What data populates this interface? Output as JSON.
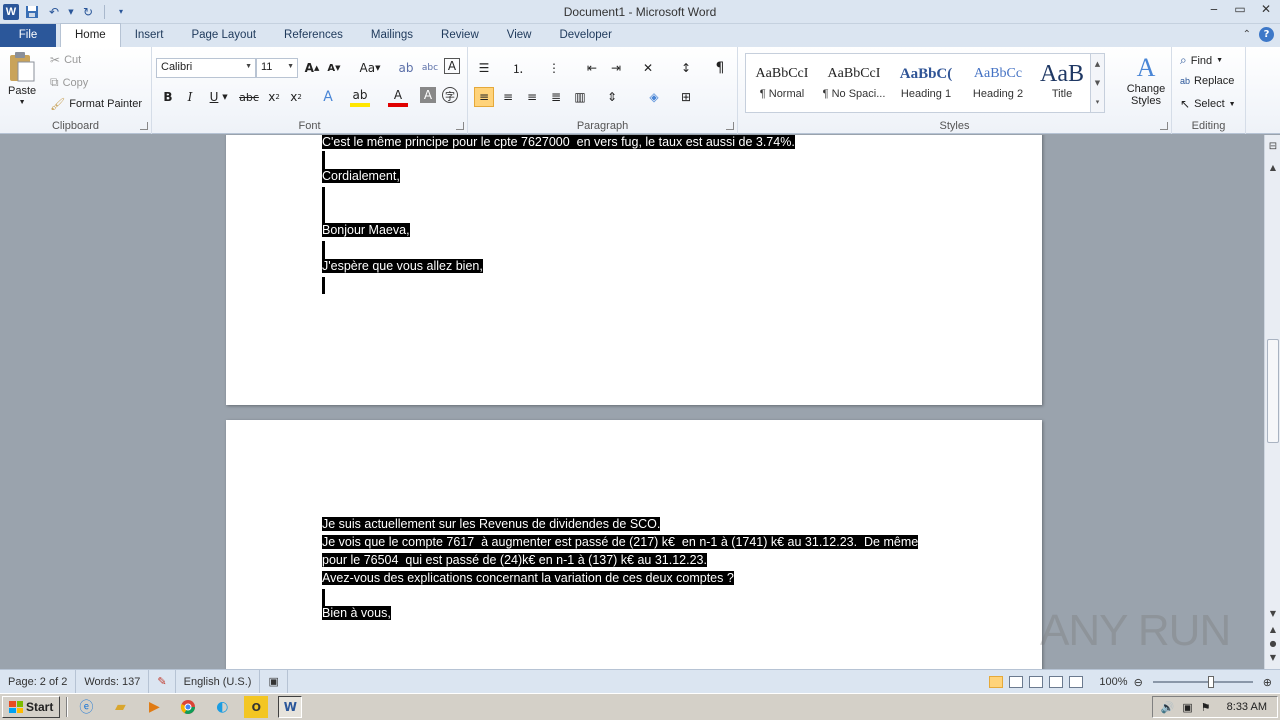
{
  "window": {
    "title": "Document1 - Microsoft Word"
  },
  "qat": {
    "save_icon": "save-icon",
    "undo_icon": "undo-icon",
    "redo_icon": "redo-icon"
  },
  "tabs": [
    "File",
    "Home",
    "Insert",
    "Page Layout",
    "References",
    "Mailings",
    "Review",
    "View",
    "Developer"
  ],
  "ribbon": {
    "clipboard": {
      "label": "Clipboard",
      "paste": "Paste",
      "cut": "Cut",
      "copy": "Copy",
      "format_painter": "Format Painter"
    },
    "font": {
      "label": "Font",
      "font_name": "Calibri",
      "font_size": "11"
    },
    "paragraph": {
      "label": "Paragraph"
    },
    "styles": {
      "label": "Styles",
      "items": [
        {
          "preview": "AaBbCcI",
          "name": "¶ Normal"
        },
        {
          "preview": "AaBbCcI",
          "name": "¶ No Spaci..."
        },
        {
          "preview": "AaBbC(",
          "name": "Heading 1"
        },
        {
          "preview": "AaBbCc",
          "name": "Heading 2"
        },
        {
          "preview": "AaB",
          "name": "Title"
        }
      ],
      "change_styles": "Change Styles"
    },
    "editing": {
      "label": "Editing",
      "find": "Find",
      "replace": "Replace",
      "select": "Select"
    }
  },
  "document": {
    "page1_lines": [
      "C'est le même principe pour le cpte 7627000  en vers fug, le taux est aussi de 3.74%.",
      "Cordialement,",
      "Bonjour Maeva,",
      "J'espère que vous allez bien,"
    ],
    "page2_lines": [
      "Je suis actuellement sur les Revenus de dividendes de SCO.",
      "Je vois que le compte 7617  à augmenter est passé de (217) k€  en n-1 à (1741) k€ au 31.12.23.  De même",
      "pour le 76504  qui est passé de (24)k€ en n-1 à (137) k€ au 31.12.23.",
      "Avez-vous des explications concernant la variation de ces deux comptes ?",
      "Bien à vous,"
    ]
  },
  "statusbar": {
    "page": "Page: 2 of 2",
    "words": "Words: 137",
    "language": "English (U.S.)",
    "zoom": "100%"
  },
  "taskbar": {
    "start": "Start",
    "clock": "8:33 AM"
  },
  "watermark": "ANY RUN"
}
